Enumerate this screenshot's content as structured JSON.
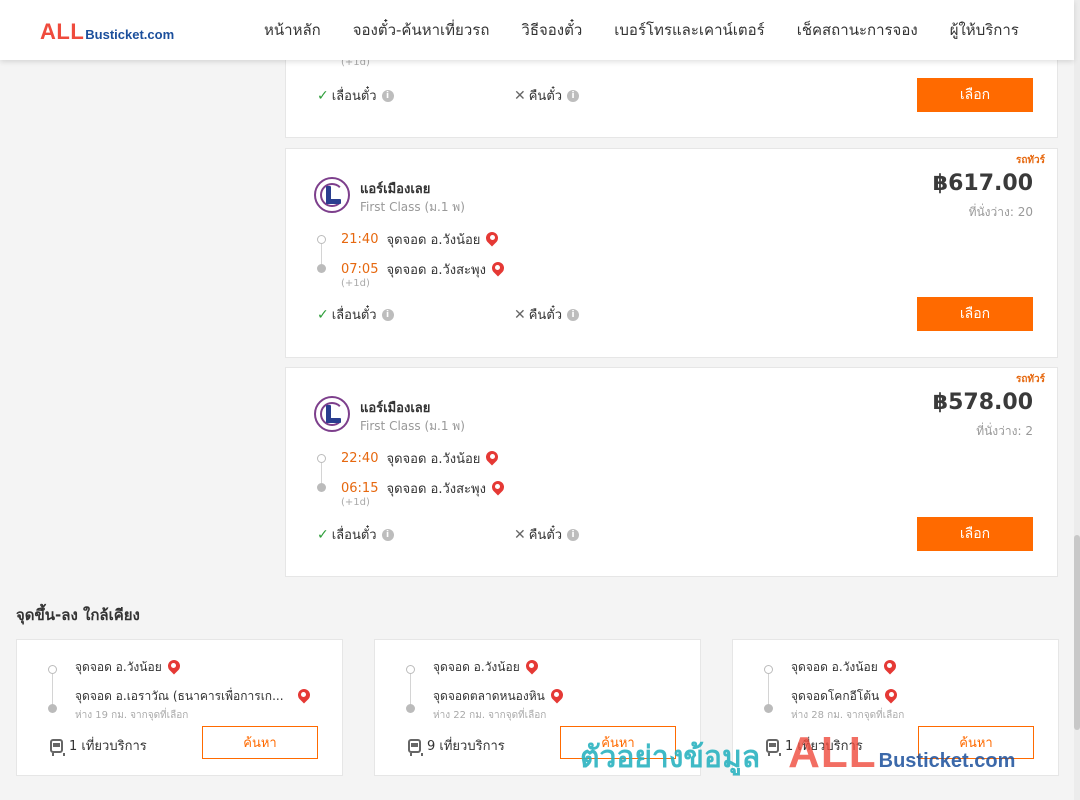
{
  "header": {
    "logo_main": "ALL",
    "logo_sub": "Busticket.com",
    "nav": [
      "หน้าหลัก",
      "จองตั๋ว-ค้นหาเที่ยวรถ",
      "วิธีจองตั๋ว",
      "เบอร์โทรและเคาน์เตอร์",
      "เช็คสถานะการจอง",
      "ผู้ให้บริการ"
    ]
  },
  "partial_card": {
    "next_day": "(+1d)",
    "reschedule_label": "เลื่อนตั๋ว",
    "refund_label": "คืนตั๋ว",
    "select_label": "เลือก"
  },
  "trips": [
    {
      "tag": "รถทัวร์",
      "company": "แอร์เมืองเลย",
      "class": "First Class (ม.1 พ)",
      "price": "฿617.00",
      "seats": "ที่นั่งว่าง: 20",
      "depart_time": "21:40",
      "depart_place": "จุดจอด อ.วังน้อย",
      "arrive_time": "07:05",
      "arrive_place": "จุดจอด อ.วังสะพุง",
      "next_day": "(+1d)",
      "reschedule_label": "เลื่อนตั๋ว",
      "refund_label": "คืนตั๋ว",
      "select_label": "เลือก"
    },
    {
      "tag": "รถทัวร์",
      "company": "แอร์เมืองเลย",
      "class": "First Class (ม.1 พ)",
      "price": "฿578.00",
      "seats": "ที่นั่งว่าง: 2",
      "depart_time": "22:40",
      "depart_place": "จุดจอด อ.วังน้อย",
      "arrive_time": "06:15",
      "arrive_place": "จุดจอด อ.วังสะพุง",
      "next_day": "(+1d)",
      "reschedule_label": "เลื่อนตั๋ว",
      "refund_label": "คืนตั๋ว",
      "select_label": "เลือก"
    }
  ],
  "nearby": {
    "title": "จุดขึ้น-ลง ใกล้เคียง",
    "items": [
      {
        "from": "จุดจอด อ.วังน้อย",
        "to": "จุดจอด อ.เอราวัณ (ธนาคารเพื่อการเก...",
        "distance": "ห่าง 19 กม. จากจุดที่เลือก",
        "trips": "1 เที่ยวบริการ",
        "search_label": "ค้นหา"
      },
      {
        "from": "จุดจอด อ.วังน้อย",
        "to": "จุดจอดตลาดหนองหิน",
        "distance": "ห่าง 22 กม. จากจุดที่เลือก",
        "trips": "9 เที่ยวบริการ",
        "search_label": "ค้นหา"
      },
      {
        "from": "จุดจอด อ.วังน้อย",
        "to": "จุดจอดโคกอีโต้น",
        "distance": "ห่าง 28 กม. จากจุดที่เลือก",
        "trips": "1 เที่ยวบริการ",
        "search_label": "ค้นหา"
      }
    ]
  },
  "watermark": {
    "thai": "ตัวอย่างข้อมูล",
    "main": "ALL",
    "sub": "Busticket.com"
  }
}
